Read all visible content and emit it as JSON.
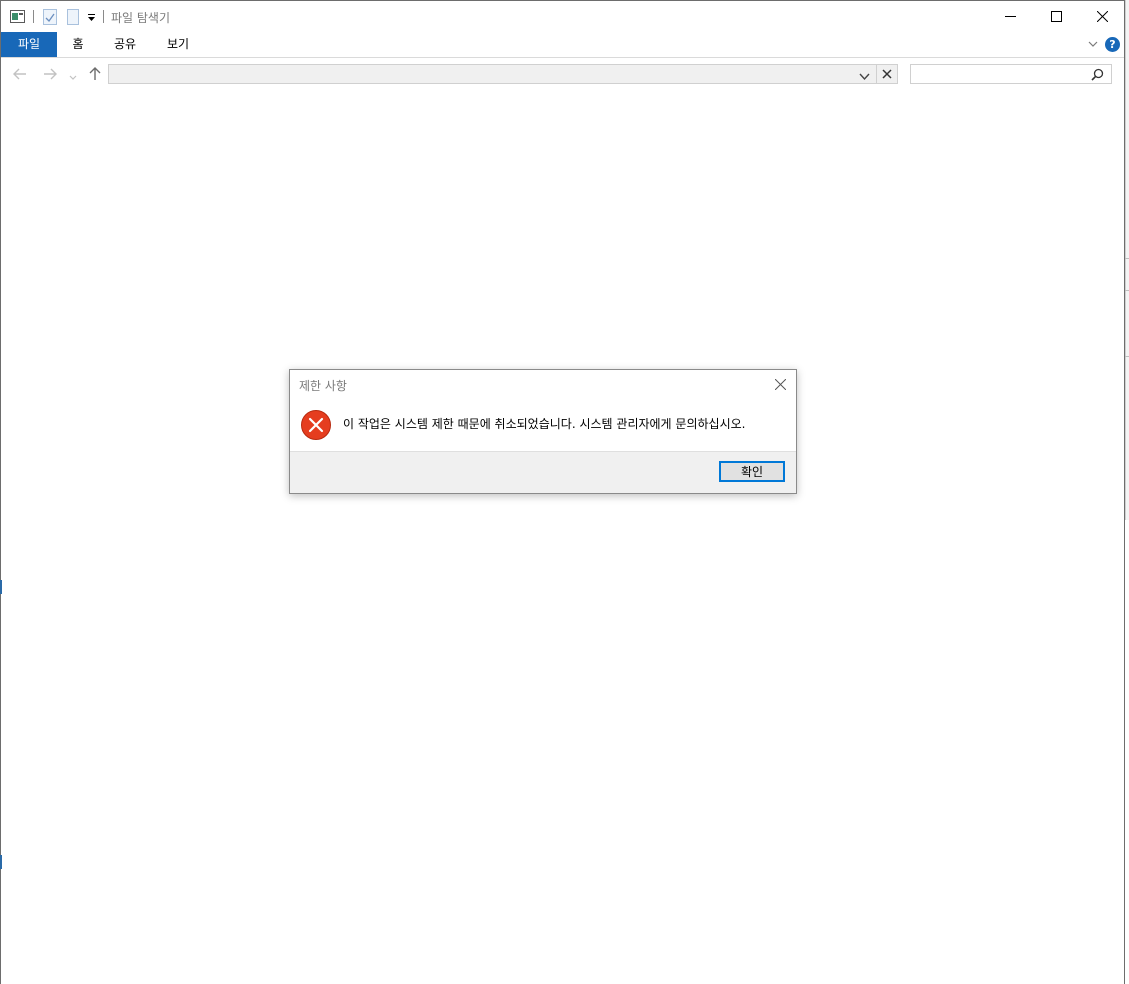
{
  "window": {
    "title": "파일 탐색기",
    "ribbon_tabs": [
      {
        "label": "파일"
      },
      {
        "label": "홈"
      },
      {
        "label": "공유"
      },
      {
        "label": "보기"
      }
    ],
    "help_label": "?",
    "accent_color": "#1868b8"
  },
  "address_bar": {
    "value": ""
  },
  "search_box": {
    "value": ""
  },
  "dialog": {
    "title": "제한 사항",
    "message": "이 작업은 시스템 제한 때문에 취소되었습니다. 시스템 관리자에게 문의하십시오.",
    "ok_label": "확인",
    "icon": "error-icon",
    "error_color": "#e53d1f"
  }
}
